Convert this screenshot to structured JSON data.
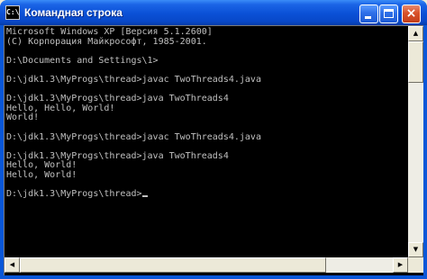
{
  "window": {
    "title": "Командная строка",
    "icon_text": "C:\\",
    "buttons": {
      "minimize": "minimize",
      "maximize": "maximize",
      "close": "×"
    }
  },
  "console": {
    "lines": [
      "Microsoft Windows XP [Версия 5.1.2600]",
      "(С) Корпорация Майкрософт, 1985-2001.",
      "",
      "D:\\Documents and Settings\\1>",
      "",
      "D:\\jdk1.3\\MyProgs\\thread>javac TwoThreads4.java",
      "",
      "D:\\jdk1.3\\MyProgs\\thread>java TwoThreads4",
      "Hello, Hello, World!",
      "World!",
      "",
      "D:\\jdk1.3\\MyProgs\\thread>javac TwoThreads4.java",
      "",
      "D:\\jdk1.3\\MyProgs\\thread>java TwoThreads4",
      "Hello, World!",
      "Hello, World!",
      "",
      "D:\\jdk1.3\\MyProgs\\thread>"
    ]
  },
  "scrollbars": {
    "up_arrow": "▲",
    "down_arrow": "▼",
    "left_arrow": "◀",
    "right_arrow": "▶"
  },
  "colors": {
    "titlebar": "#0a50d6",
    "console_bg": "#000000",
    "console_text": "#c0c0c0"
  }
}
